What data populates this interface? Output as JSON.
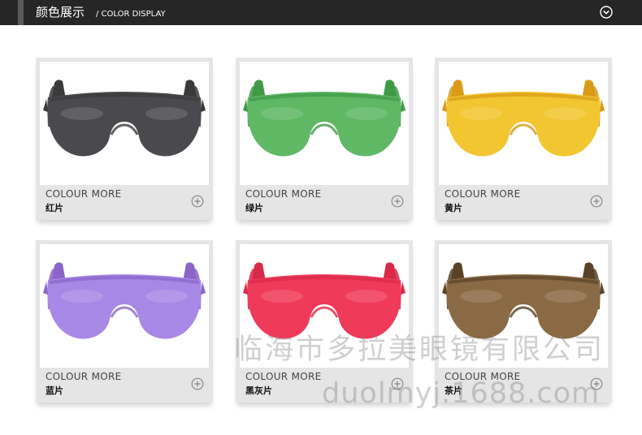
{
  "header": {
    "title": "颜色展示",
    "subtitle": "/ COLOR DISPLAY",
    "icon": "chevron-down-circle-icon"
  },
  "products": [
    {
      "colour_label": "COLOUR MORE",
      "name": "红片",
      "frame_color": "#3a3a3a",
      "lens_color": "#4a4a4e"
    },
    {
      "colour_label": "COLOUR MORE",
      "name": "绿片",
      "frame_color": "#3f9a48",
      "lens_color": "#5fb864"
    },
    {
      "colour_label": "COLOUR MORE",
      "name": "黄片",
      "frame_color": "#d89a18",
      "lens_color": "#f2c630"
    },
    {
      "colour_label": "COLOUR MORE",
      "name": "蓝片",
      "frame_color": "#8a64c8",
      "lens_color": "#a888e6"
    },
    {
      "colour_label": "COLOUR MORE",
      "name": "黑灰片",
      "frame_color": "#d82a48",
      "lens_color": "#f03a5a"
    },
    {
      "colour_label": "COLOUR MORE",
      "name": "茶片",
      "frame_color": "#5a4228",
      "lens_color": "#8a6a44"
    }
  ],
  "watermark": {
    "company": "临海市多拉美眼镜有限公司",
    "url": "duolmyj.1688.com"
  }
}
